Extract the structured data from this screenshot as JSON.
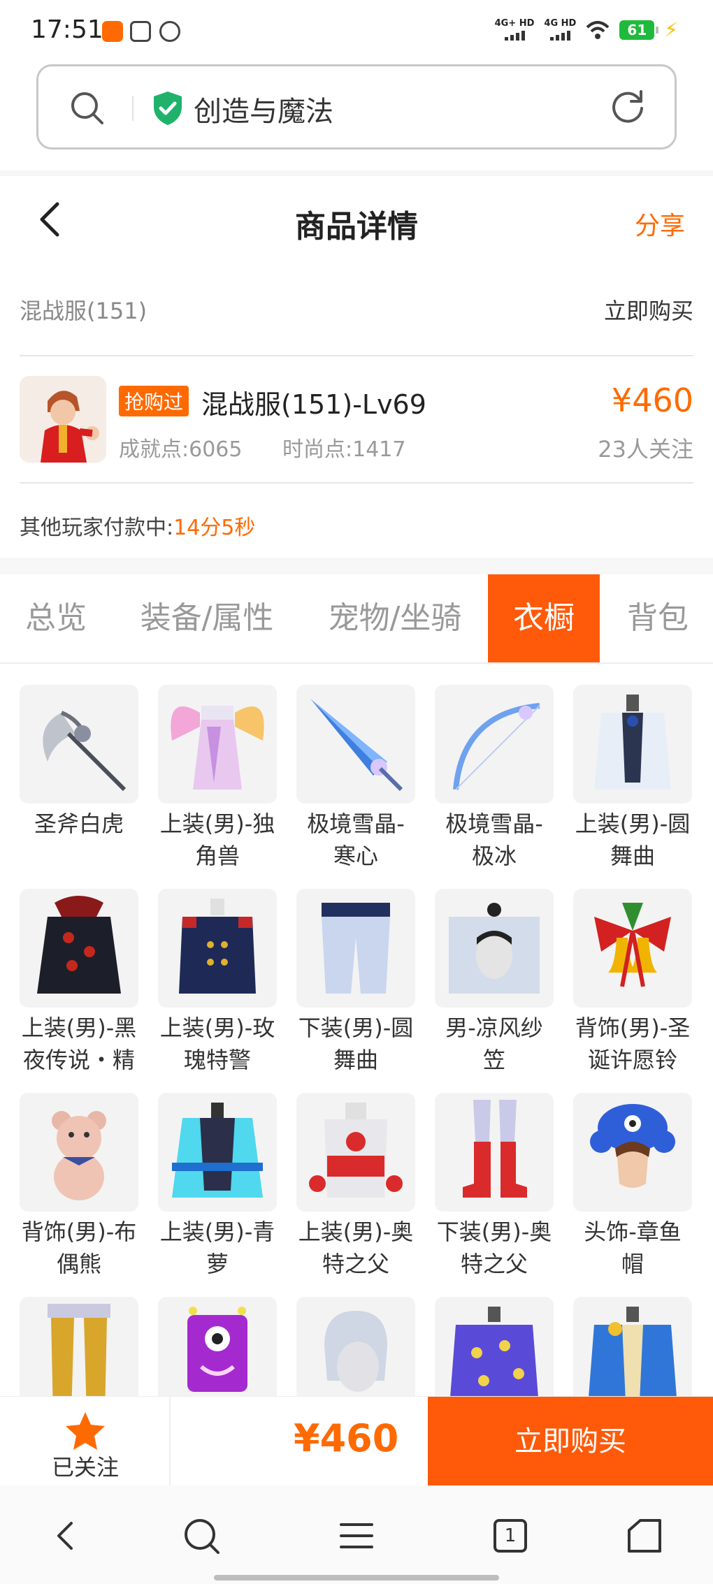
{
  "status_bar": {
    "time": "17:51",
    "network1": "4G+ HD",
    "network2": "4G HD",
    "battery": "61"
  },
  "search": {
    "text": "创造与魔法"
  },
  "header": {
    "title": "商品详情",
    "share": "分享"
  },
  "listing": {
    "server": "混战服(151)",
    "buy_now_link": "立即购买",
    "tag": "抢购过",
    "name": "混战服(151)-Lv69",
    "price": "¥460",
    "achievement": "成就点:6065",
    "fashion": "时尚点:1417",
    "followers": "23人关注",
    "paying_label": "其他玩家付款中:",
    "paying_time": "14分5秒"
  },
  "tabs": [
    {
      "label": "总览"
    },
    {
      "label": "装备/属性"
    },
    {
      "label": "宠物/坐骑"
    },
    {
      "label": "衣橱"
    },
    {
      "label": "背包"
    }
  ],
  "wardrobe": {
    "items": [
      {
        "line1": "圣斧白虎",
        "line2": "",
        "icon": "axe-icon"
      },
      {
        "line1": "上装(男)-独",
        "line2": "角兽",
        "icon": "unicorn-outfit-icon"
      },
      {
        "line1": "极境雪晶-",
        "line2": "寒心",
        "icon": "ice-sword-icon"
      },
      {
        "line1": "极境雪晶-",
        "line2": "极冰",
        "icon": "ice-bow-icon"
      },
      {
        "line1": "上装(男)-圆",
        "line2": "舞曲",
        "icon": "waltz-jacket-icon"
      },
      {
        "line1": "上装(男)-黑",
        "line2": "夜传说・精",
        "icon": "night-legend-coat-icon"
      },
      {
        "line1": "上装(男)-玫",
        "line2": "瑰特警",
        "icon": "rose-police-coat-icon"
      },
      {
        "line1": "下装(男)-圆",
        "line2": "舞曲",
        "icon": "waltz-pants-icon"
      },
      {
        "line1": "男-凉风纱",
        "line2": "笠",
        "icon": "veil-hat-icon"
      },
      {
        "line1": "背饰(男)-圣",
        "line2": "诞许愿铃",
        "icon": "christmas-bell-icon"
      },
      {
        "line1": "背饰(男)-布",
        "line2": "偶熊",
        "icon": "teddy-bear-icon"
      },
      {
        "line1": "上装(男)-青",
        "line2": "萝",
        "icon": "cyan-robe-icon"
      },
      {
        "line1": "上装(男)-奥",
        "line2": "特之父",
        "icon": "ultra-top-icon"
      },
      {
        "line1": "下装(男)-奥",
        "line2": "特之父",
        "icon": "ultra-boots-icon"
      },
      {
        "line1": "头饰-章鱼",
        "line2": "帽",
        "icon": "octopus-hat-icon"
      },
      {
        "line1": "",
        "line2": "",
        "icon": "gold-boots-icon"
      },
      {
        "line1": "",
        "line2": "",
        "icon": "purple-monster-icon"
      },
      {
        "line1": "",
        "line2": "",
        "icon": "silver-hair-icon"
      },
      {
        "line1": "",
        "line2": "",
        "icon": "purple-shirt-icon"
      },
      {
        "line1": "",
        "line2": "",
        "icon": "blue-jacket-icon"
      }
    ]
  },
  "action_bar": {
    "follow_label": "已关注",
    "price": "¥460",
    "buy_label": "立即购买"
  },
  "system_nav": {
    "tab_count": "1"
  },
  "colors": {
    "accent": "#ff6a00",
    "tab_active": "#ff5a0a",
    "shield": "#20b26b"
  }
}
